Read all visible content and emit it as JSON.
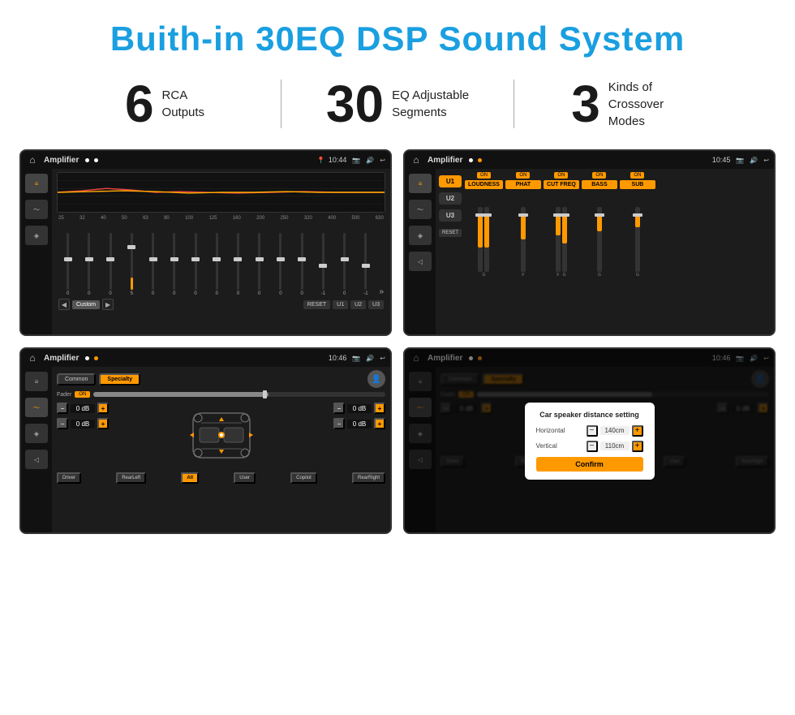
{
  "page": {
    "title": "Buith-in 30EQ DSP Sound System",
    "stats": [
      {
        "number": "6",
        "label": "RCA\nOutputs"
      },
      {
        "number": "30",
        "label": "EQ Adjustable\nSegments"
      },
      {
        "number": "3",
        "label": "Kinds of\nCrossover Modes"
      }
    ]
  },
  "screens": [
    {
      "id": "eq-screen",
      "statusBar": {
        "title": "Amplifier",
        "time": "10:44",
        "dots": [
          "white",
          "white"
        ]
      },
      "type": "equalizer"
    },
    {
      "id": "crossover-screen",
      "statusBar": {
        "title": "Amplifier",
        "time": "10:45",
        "dots": [
          "white",
          "orange"
        ]
      },
      "type": "crossover"
    },
    {
      "id": "fader-screen",
      "statusBar": {
        "title": "Amplifier",
        "time": "10:46",
        "dots": [
          "white",
          "orange"
        ]
      },
      "type": "fader"
    },
    {
      "id": "distance-screen",
      "statusBar": {
        "title": "Amplifier",
        "time": "10:46",
        "dots": [
          "white",
          "orange"
        ]
      },
      "type": "distance",
      "dialog": {
        "title": "Car speaker distance setting",
        "fields": [
          {
            "label": "Horizontal",
            "value": "140cm"
          },
          {
            "label": "Vertical",
            "value": "110cm"
          }
        ],
        "confirmLabel": "Confirm"
      }
    }
  ],
  "eq": {
    "frequencies": [
      "25",
      "32",
      "40",
      "50",
      "63",
      "80",
      "100",
      "125",
      "160",
      "200",
      "250",
      "320",
      "400",
      "500",
      "630"
    ],
    "values": [
      "0",
      "0",
      "0",
      "5",
      "0",
      "0",
      "0",
      "0",
      "0",
      "0",
      "0",
      "0",
      "-1",
      "0",
      "-1"
    ],
    "presets": [
      "Custom",
      "RESET",
      "U1",
      "U2",
      "U3"
    ]
  },
  "crossover": {
    "users": [
      "U1",
      "U2",
      "U3"
    ],
    "channels": [
      "LOUDNESS",
      "PHAT",
      "CUT FREQ",
      "BASS",
      "SUB"
    ],
    "resetLabel": "RESET"
  },
  "fader": {
    "tabs": [
      "Common",
      "Specialty"
    ],
    "faderLabel": "Fader",
    "onLabel": "ON",
    "positions": [
      "Driver",
      "Copilot",
      "RearLeft",
      "All",
      "RearRight",
      "User"
    ],
    "volumeLabels": [
      "0 dB",
      "0 dB",
      "0 dB",
      "0 dB"
    ]
  },
  "distance": {
    "tabs": [
      "Common",
      "Specialty"
    ],
    "faderLabel": "Fader",
    "onLabel": "ON",
    "dialog": {
      "title": "Car speaker distance setting",
      "horizontalLabel": "Horizontal",
      "horizontalValue": "140cm",
      "verticalLabel": "Vertical",
      "verticalValue": "110cm",
      "confirmLabel": "Confirm"
    }
  }
}
